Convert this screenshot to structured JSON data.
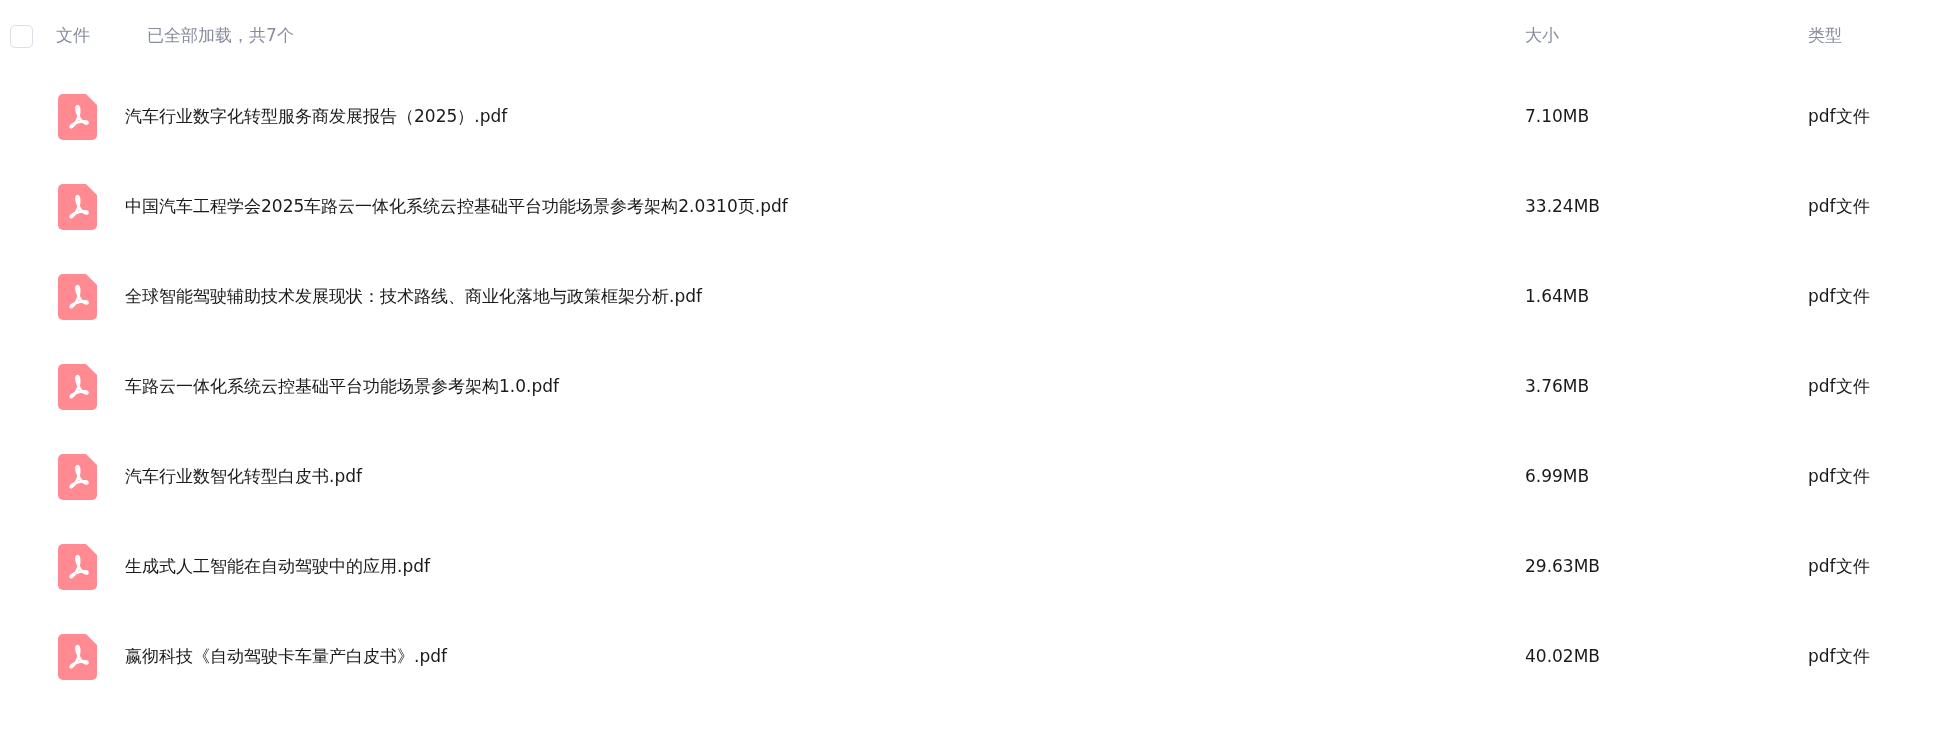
{
  "header": {
    "select_all": {
      "checked": false
    },
    "name_label": "文件",
    "load_status": "已全部加载，共7个",
    "size_label": "大小",
    "type_label": "类型"
  },
  "files": [
    {
      "name": "汽车行业数字化转型服务商发展报告（2025）.pdf",
      "size": "7.10MB",
      "type": "pdf文件"
    },
    {
      "name": "中国汽车工程学会2025车路云一体化系统云控基础平台功能场景参考架构2.0310页.pdf",
      "size": "33.24MB",
      "type": "pdf文件"
    },
    {
      "name": "全球智能驾驶辅助技术发展现状：技术路线、商业化落地与政策框架分析.pdf",
      "size": "1.64MB",
      "type": "pdf文件"
    },
    {
      "name": "车路云一体化系统云控基础平台功能场景参考架构1.0.pdf",
      "size": "3.76MB",
      "type": "pdf文件"
    },
    {
      "name": "汽车行业数智化转型白皮书.pdf",
      "size": "6.99MB",
      "type": "pdf文件"
    },
    {
      "name": "生成式人工智能在自动驾驶中的应用.pdf",
      "size": "29.63MB",
      "type": "pdf文件"
    },
    {
      "name": "嬴彻科技《自动驾驶卡车量产白皮书》.pdf",
      "size": "40.02MB",
      "type": "pdf文件"
    }
  ]
}
